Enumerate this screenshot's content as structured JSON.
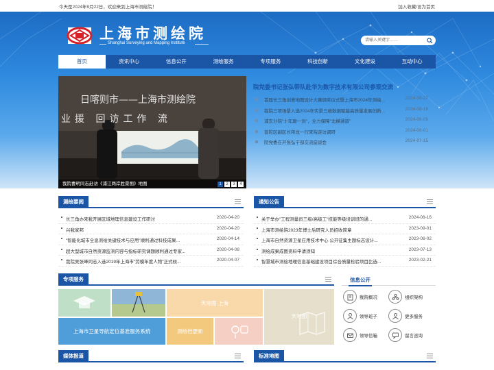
{
  "topbar": {
    "greeting": "今天是2024年9月22日，欢迎来到上海市测绘院！",
    "add_favorite": "加入收藏",
    "separator": "/",
    "set_homepage": "设为首页"
  },
  "header": {
    "site_name_cn": "上海市测绘院",
    "site_name_en": "Shanghai Surveying and Mapping Institute",
    "search_placeholder": "请输入关键字……"
  },
  "nav": [
    "首页",
    "资讯中心",
    "信息公开",
    "测绘服务",
    "专项服务",
    "科技创新",
    "文化建设",
    "互动中心"
  ],
  "slideshow": {
    "banner_text_line1": "日喀则市——上海市测绘院",
    "banner_text_line2": "业援  回访工作  流",
    "caption": "我院曹明同志赴访《浦江两岸胜景图》地图",
    "pages": [
      "1",
      "2",
      "3",
      "4"
    ],
    "active_page": 1
  },
  "headline": {
    "title": "院党委书记张弘带队赴华为数字技术有限公司参观交流",
    "items": [
      {
        "title": "首届长三角创意地图设计大赛颁奖仪式暨上海市2024年测绘...",
        "date": "2024-08-27"
      },
      {
        "title": "我院三项场景入选2024年实景三维数据赋能高质量发展创新...",
        "date": "2024-08-19"
      },
      {
        "title": "浦东分院\"十年磨一剑\"，全力保障\"北横通道\"",
        "date": "2024-08-05"
      },
      {
        "title": "普陀区副区长蒋龙一行来院走访调研",
        "date": "2024-08-01"
      },
      {
        "title": "院党委召开张弘干部交流座谈会",
        "date": "2024-07-15"
      }
    ]
  },
  "survey_news": {
    "title": "测绘要闻",
    "items": [
      {
        "title": "长三角办来我开展区域地理信息建设工作研讨",
        "date": "2020-04-20"
      },
      {
        "title": "兴我家邦",
        "date": "2020-04-20"
      },
      {
        "title": "\"智能化城市全息测绘关键技术与应用\"顺利通过科技成果...",
        "date": "2020-04-14"
      },
      {
        "title": "超大型城市自然资源监测内容与指标研究课题顺利通过专家...",
        "date": "2020-04-08"
      },
      {
        "title": "我院吴张峰同志入选2019年上海市\"劳模年度人物\"正式候...",
        "date": "2020-04-07"
      }
    ]
  },
  "notices": {
    "title": "通知公告",
    "items": [
      {
        "title": "关于举办\"工程测量员三级/高级工\"技能等级培训班的通...",
        "date": "2024-08-16"
      },
      {
        "title": "上海市测绘院2023年博士后研究人员招收简章",
        "date": "2023-09-01"
      },
      {
        "title": "上海市自然资源卫星应用技术中心 公开征集主题标志设计...",
        "date": "2023-08-02"
      },
      {
        "title": "测绘成果成图资料申请须知",
        "date": "2023-07-13"
      },
      {
        "title": "智慧城市测绘地理信息基础建设项目综合质量检验项目比选...",
        "date": "2023-02-21"
      }
    ]
  },
  "special_services": {
    "title": "专项服务",
    "tiles": {
      "tile1": "",
      "tile2": "",
      "map_shanghai": "天地图·上海",
      "map_china": "天地图",
      "satellite": "上海市卫星导航定位基准服务系统",
      "mapping": "测绘档更新"
    }
  },
  "info_public": {
    "title": "信息公开",
    "items": [
      {
        "label": "我院概况",
        "icon": "building-icon"
      },
      {
        "label": "组织架构",
        "icon": "org-chart-icon"
      },
      {
        "label": "领导班子",
        "icon": "person-icon"
      },
      {
        "label": "更多服务",
        "icon": "person-icon"
      },
      {
        "label": "领导信箱",
        "icon": "mail-icon"
      },
      {
        "label": "留言咨询",
        "icon": "chat-icon"
      }
    ]
  },
  "media": {
    "title": "媒体报道"
  },
  "standard_map": {
    "title": "标准地图"
  },
  "colors": {
    "primary": "#1a55a6",
    "accent": "#2e89de"
  }
}
